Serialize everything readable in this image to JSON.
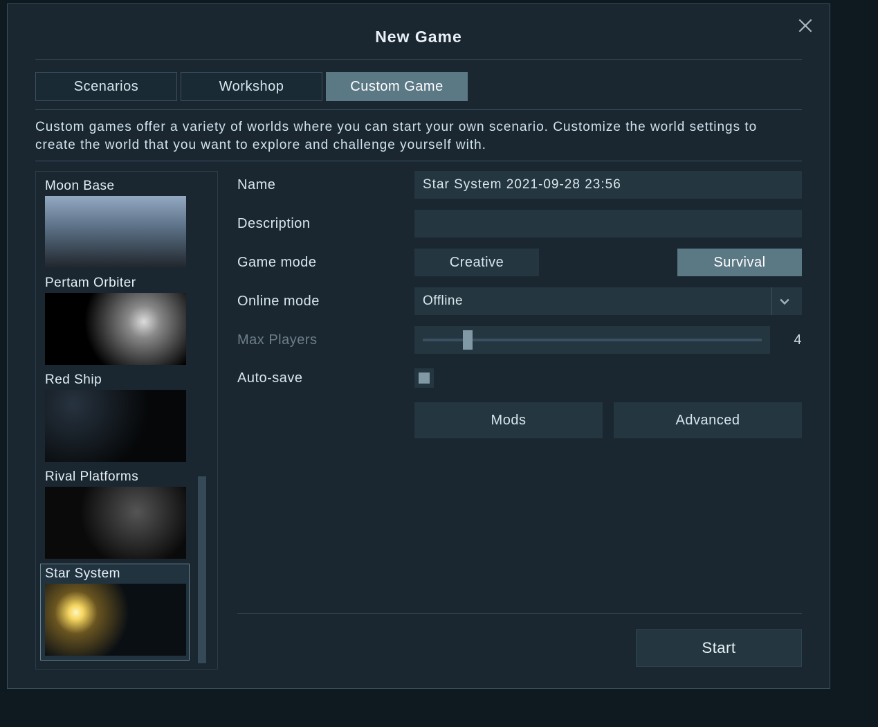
{
  "header": {
    "title": "New Game"
  },
  "tabs": [
    {
      "label": "Scenarios",
      "active": false
    },
    {
      "label": "Workshop",
      "active": false
    },
    {
      "label": "Custom Game",
      "active": true
    }
  ],
  "description": "Custom games offer a variety of worlds where you can start your own scenario. Customize the world settings to create the world that you want to explore and challenge yourself with.",
  "worlds": {
    "items": [
      {
        "label": "Moon Base",
        "selected": false
      },
      {
        "label": "Pertam Orbiter",
        "selected": false
      },
      {
        "label": "Red Ship",
        "selected": false
      },
      {
        "label": "Rival Platforms",
        "selected": false
      },
      {
        "label": "Star System",
        "selected": true
      }
    ]
  },
  "form": {
    "name_label": "Name",
    "name_value": "Star System 2021-09-28 23:56",
    "description_label": "Description",
    "description_value": "",
    "game_mode_label": "Game mode",
    "creative_label": "Creative",
    "survival_label": "Survival",
    "game_mode_selected": "Survival",
    "online_mode_label": "Online mode",
    "online_mode_value": "Offline",
    "max_players_label": "Max Players",
    "max_players_value": "4",
    "autosave_label": "Auto-save",
    "autosave_checked": true,
    "mods_label": "Mods",
    "advanced_label": "Advanced"
  },
  "footer": {
    "start_label": "Start"
  }
}
